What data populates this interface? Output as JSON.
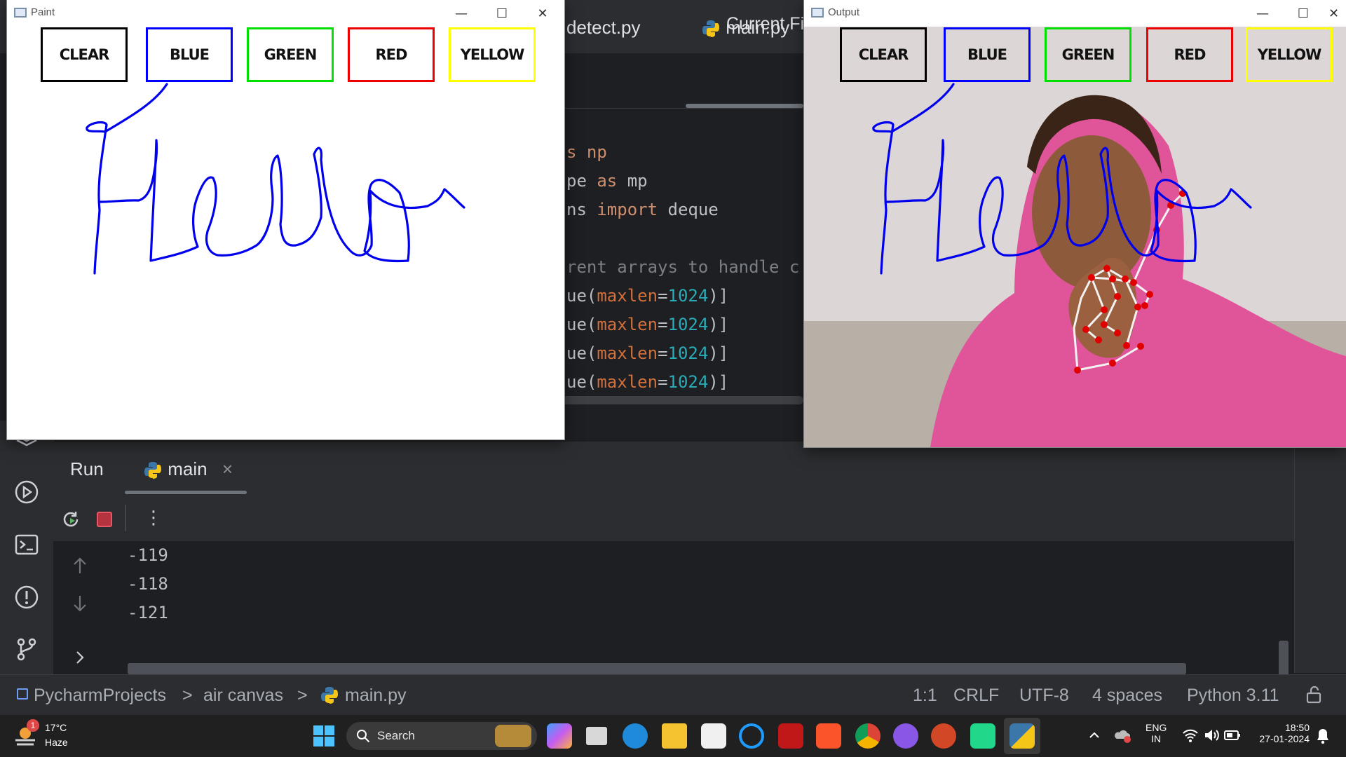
{
  "ide": {
    "title": "Current Fi",
    "tabs": [
      {
        "label": "detect.py"
      },
      {
        "label": "main.py"
      }
    ],
    "code_lines": [
      {
        "pre": "s np",
        "kw": "",
        "post": ""
      },
      {
        "pre": "pe ",
        "kw": "as",
        "post": " mp"
      },
      {
        "pre": "ns ",
        "kw": "import",
        "post": " deque"
      },
      {
        "comment": "rent arrays to handle c"
      },
      {
        "pre": "ue(",
        "param": "maxlen",
        "eq": "=",
        "num": "1024",
        "post": ")]"
      },
      {
        "pre": "ue(",
        "param": "maxlen",
        "eq": "=",
        "num": "1024",
        "post": ")]"
      },
      {
        "pre": "ue(",
        "param": "maxlen",
        "eq": "=",
        "num": "1024",
        "post": ")]"
      },
      {
        "pre": "ue(",
        "param": "maxlen",
        "eq": "=",
        "num": "1024",
        "post": ")]"
      }
    ],
    "run_panel": {
      "label": "Run",
      "tab": "main",
      "close": "×",
      "more": "⋮"
    },
    "console_lines": [
      "-119",
      "-118",
      "-121"
    ],
    "breadcrumb": {
      "project": "PycharmProjects",
      "folder": "air canvas",
      "file": "main.py",
      "sep": ">"
    },
    "status": {
      "position": "1:1",
      "line_ending": "CRLF",
      "encoding": "UTF-8",
      "indent": "4 spaces",
      "interpreter": "Python 3.11"
    }
  },
  "paint_window": {
    "title": "Paint",
    "buttons": [
      {
        "label": "CLEAR",
        "color": "#000000"
      },
      {
        "label": "BLUE",
        "color": "#0000ff"
      },
      {
        "label": "GREEN",
        "color": "#00e000"
      },
      {
        "label": "RED",
        "color": "#ee0000"
      },
      {
        "label": "YELLOW",
        "color": "#ffff00"
      }
    ],
    "stroke_color": "#0000ee"
  },
  "output_window": {
    "title": "Output",
    "buttons": [
      {
        "label": "CLEAR",
        "color": "#000000"
      },
      {
        "label": "BLUE",
        "color": "#0000ff"
      },
      {
        "label": "GREEN",
        "color": "#00e000"
      },
      {
        "label": "RED",
        "color": "#ee0000"
      },
      {
        "label": "YELLOW",
        "color": "#ffff00"
      }
    ]
  },
  "window_controls": {
    "minimize": "—",
    "maximize": "☐",
    "close": "✕"
  },
  "taskbar": {
    "weather": {
      "temp": "17°C",
      "condition": "Haze",
      "badge": "1"
    },
    "search_label": "Search",
    "language": {
      "line1": "ENG",
      "line2": "IN"
    },
    "clock": {
      "time": "18:50",
      "date": "27-01-2024"
    },
    "apps": [
      "copilot-icon",
      "task-view-icon",
      "edge-icon",
      "file-explorer-icon",
      "store-icon",
      "cortana-icon",
      "mcafee-icon",
      "brave-icon",
      "chrome-icon",
      "github-icon",
      "powerpoint-icon",
      "pycharm-icon",
      "python-icon"
    ]
  }
}
